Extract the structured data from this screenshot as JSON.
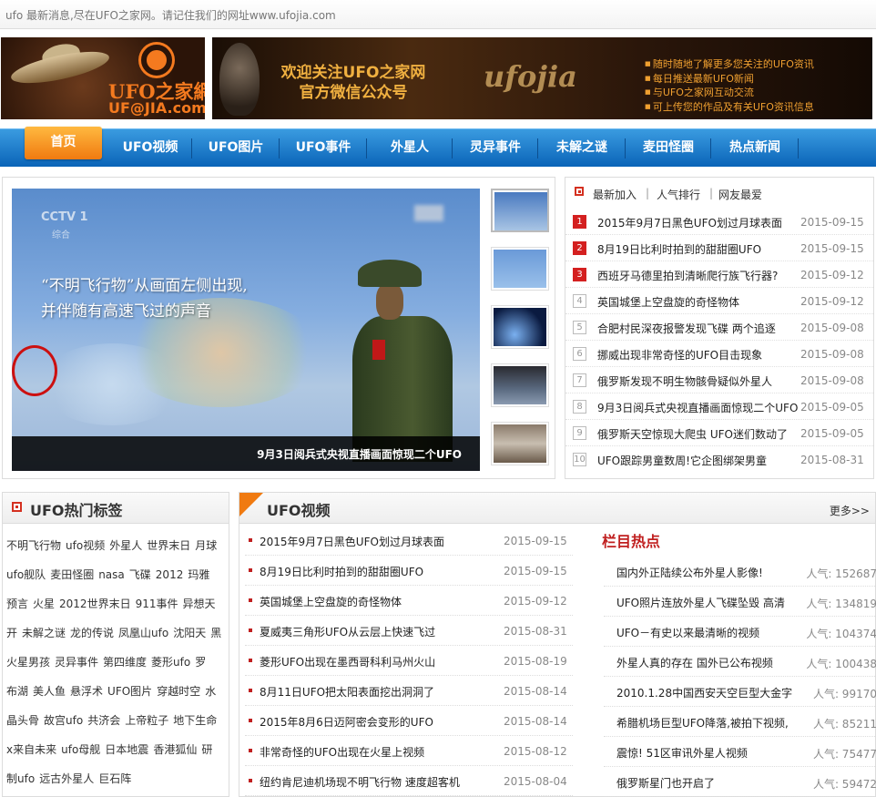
{
  "topbar": {
    "text": "ufo  最新消息,尽在UFO之家网。请记住我们的网址www.ufojia.com"
  },
  "logo": {
    "cn": "UFO之家網",
    "en": "UF@JIA.com"
  },
  "banner": {
    "main_line1": "欢迎关注UFO之家网",
    "main_line2": "官方微信公众号",
    "brand": "ufojia",
    "points": [
      "随时随地了解更多您关注的UFO资讯",
      "每日推送最新UFO新闻",
      "与UFO之家网互动交流",
      "可上传您的作品及有关UFO资讯信息"
    ]
  },
  "nav": {
    "home": "首页",
    "items": [
      "UFO视频",
      "UFO图片",
      "UFO事件",
      "外星人",
      "灵异事件",
      "未解之谜",
      "麦田怪圈",
      "热点新闻"
    ]
  },
  "slider": {
    "channel": "CCTV 1",
    "channel_sub": "综合",
    "caption_line1": "“不明飞行物”从画面左侧出现,",
    "caption_line2": "并伴随有高速飞过的声音",
    "title": "9月3日阅兵式央视直播画面惊现二个UFO"
  },
  "news_tabs": [
    "最新加入",
    "人气排行",
    "网友最爱"
  ],
  "news": [
    {
      "num": "1",
      "title": "2015年9月7日黑色UFO划过月球表面",
      "date": "2015-09-15"
    },
    {
      "num": "2",
      "title": "8月19日比利时拍到的甜甜圈UFO",
      "date": "2015-09-15"
    },
    {
      "num": "3",
      "title": "西班牙马德里拍到清晰爬行族飞行器?",
      "date": "2015-09-12"
    },
    {
      "num": "4",
      "title": "英国城堡上空盘旋的奇怪物体",
      "date": "2015-09-12"
    },
    {
      "num": "5",
      "title": "合肥村民深夜报警发现飞碟 两个追逐",
      "date": "2015-09-08"
    },
    {
      "num": "6",
      "title": "挪威出现非常奇怪的UFO目击现象",
      "date": "2015-09-08"
    },
    {
      "num": "7",
      "title": "俄罗斯发现不明生物骸骨疑似外星人",
      "date": "2015-09-08"
    },
    {
      "num": "8",
      "title": "9月3日阅兵式央视直播画面惊现二个UFO",
      "date": "2015-09-05"
    },
    {
      "num": "9",
      "title": "俄罗斯天空惊现大爬虫 UFO迷们数动了",
      "date": "2015-09-05"
    },
    {
      "num": "10",
      "title": "UFO跟踪男童数周!它企图绑架男童",
      "date": "2015-08-31"
    }
  ],
  "tags": {
    "heading": "UFO热门标签",
    "items": [
      "不明飞行物",
      "ufo视频",
      "外星人",
      "世界末日",
      "月球",
      "ufo舰队",
      "麦田怪圈",
      "nasa",
      "飞碟",
      "2012",
      "玛雅",
      "预言",
      "火星",
      "2012世界末日",
      "911事件",
      "异想天",
      "开",
      "未解之谜",
      "龙的传说",
      "凤凰山ufo",
      "沈阳天",
      "黑",
      "火星男孩",
      "灵异事件",
      "第四维度",
      "菱形ufo",
      "罗",
      "布湖",
      "美人鱼",
      "悬浮术",
      "UFO图片",
      "穿越时空",
      "水",
      "晶头骨",
      "故宫ufo",
      "共济会",
      "上帝粒子",
      "地下生命",
      "x来自未来",
      "ufo母舰",
      "日本地震",
      "香港狐仙",
      "研",
      "制ufo",
      "远古外星人",
      "巨石阵"
    ]
  },
  "video": {
    "heading": "UFO视频",
    "more": "更多>>",
    "items": [
      {
        "title": "2015年9月7日黑色UFO划过月球表面",
        "date": "2015-09-15"
      },
      {
        "title": "8月19日比利时拍到的甜甜圈UFO",
        "date": "2015-09-15"
      },
      {
        "title": "英国城堡上空盘旋的奇怪物体",
        "date": "2015-09-12"
      },
      {
        "title": "夏威夷三角形UFO从云层上快速飞过",
        "date": "2015-08-31"
      },
      {
        "title": "菱形UFO出现在墨西哥科利马州火山",
        "date": "2015-08-19"
      },
      {
        "title": "8月11日UFO把太阳表面挖出洞洞了",
        "date": "2015-08-14"
      },
      {
        "title": "2015年8月6日迈阿密会变形的UFO",
        "date": "2015-08-14"
      },
      {
        "title": "非常奇怪的UFO出现在火星上视频",
        "date": "2015-08-12"
      },
      {
        "title": "纽约肯尼迪机场现不明飞行物 速度超客机",
        "date": "2015-08-04"
      }
    ]
  },
  "hot": {
    "heading": "栏目热点",
    "items": [
      {
        "title": "国内外正陆续公布外星人影像!",
        "pop": "人气: 152687"
      },
      {
        "title": "UFO照片连放外星人飞碟坠毁 高清",
        "pop": "人气: 134819"
      },
      {
        "title": "UFO－有史以来最清晰的视频",
        "pop": "人气: 104374"
      },
      {
        "title": "外星人真的存在 国外已公布视频",
        "pop": "人气: 100438"
      },
      {
        "title": "2010.1.28中国西安天空巨型大金字",
        "pop": "人气: 99170"
      },
      {
        "title": "希腊机场巨型UFO降落,被拍下视频,",
        "pop": "人气: 85211"
      },
      {
        "title": "震惊! 51区审讯外星人视频",
        "pop": "人气: 75477"
      },
      {
        "title": "俄罗斯星门也开启了",
        "pop": "人气: 59472"
      }
    ]
  }
}
